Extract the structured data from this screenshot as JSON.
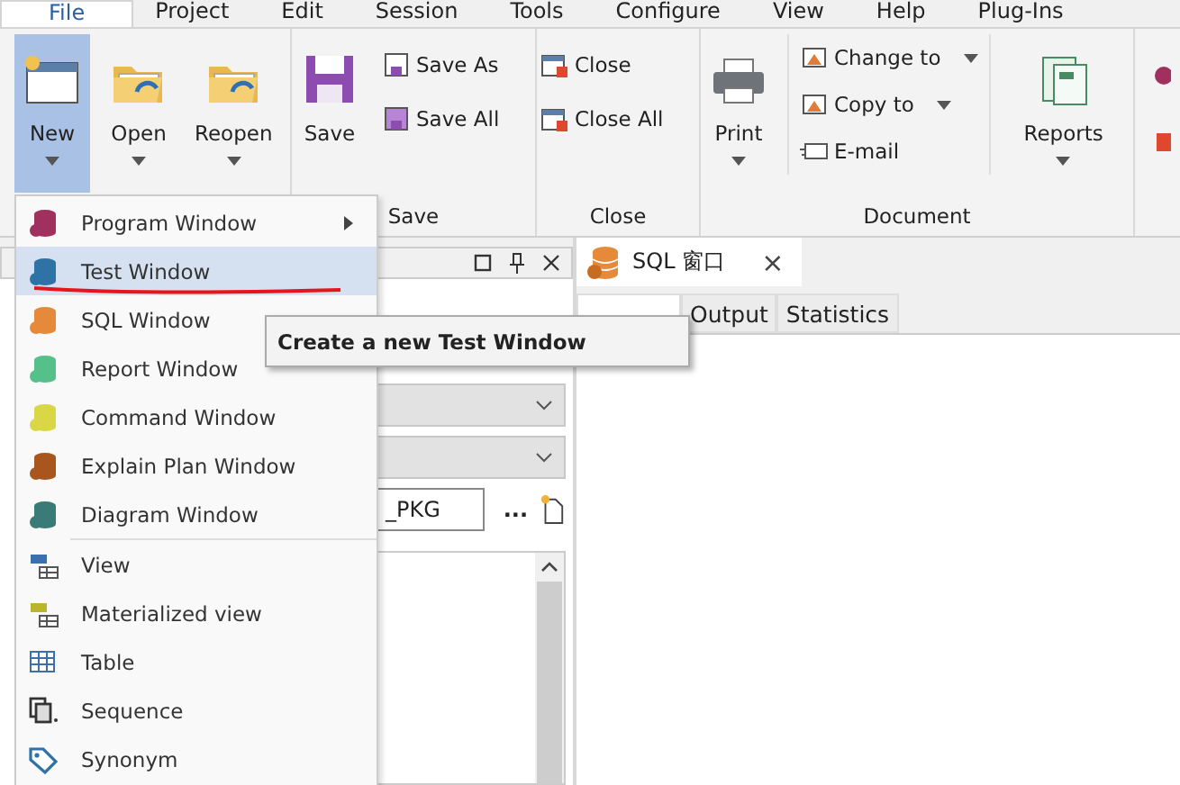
{
  "menu_bar": [
    {
      "label": "File",
      "selected": true
    },
    {
      "label": "Project",
      "selected": false
    },
    {
      "label": "Edit",
      "selected": false
    },
    {
      "label": "Session",
      "selected": false
    },
    {
      "label": "Tools",
      "selected": false
    },
    {
      "label": "Configure",
      "selected": false
    },
    {
      "label": "View",
      "selected": false
    },
    {
      "label": "Help",
      "selected": false
    },
    {
      "label": "Plug-Ins",
      "selected": false
    }
  ],
  "ribbon": {
    "groups": [
      {
        "buttons": [
          {
            "label": "New",
            "dropdown": true,
            "selected": true
          },
          {
            "label": "Open",
            "dropdown": true,
            "selected": false
          },
          {
            "label": "Reopen",
            "dropdown": true,
            "selected": false
          }
        ]
      },
      {
        "label": "Save",
        "buttons": [
          {
            "label": "Save",
            "dropdown": false,
            "selected": false
          },
          {
            "label": "Save As",
            "dropdown": false,
            "selected": false
          },
          {
            "label": "Save All",
            "dropdown": false,
            "selected": false
          }
        ]
      },
      {
        "label": "Close",
        "buttons": [
          {
            "label": "Close",
            "dropdown": false,
            "selected": false
          },
          {
            "label": "Close All",
            "dropdown": false,
            "selected": false
          }
        ]
      },
      {
        "label": "Document",
        "buttons": [
          {
            "label": "Print",
            "dropdown": true,
            "selected": false
          },
          {
            "label": "Change to",
            "dropdown": true,
            "selected": false
          },
          {
            "label": "Copy to",
            "dropdown": true,
            "selected": false
          },
          {
            "label": "E-mail",
            "dropdown": false,
            "selected": false
          },
          {
            "label": "Reports",
            "dropdown": true,
            "selected": false
          }
        ]
      }
    ]
  },
  "new_menu": {
    "items": [
      {
        "kind": "window",
        "label": "Program Window",
        "color": "#a0305e",
        "submenu": true,
        "selected": false
      },
      {
        "kind": "window",
        "label": "Test Window",
        "color": "#2f73a6",
        "submenu": false,
        "selected": true
      },
      {
        "kind": "window",
        "label": "SQL Window",
        "color": "#e48a3a",
        "submenu": false,
        "selected": false
      },
      {
        "kind": "window",
        "label": "Report Window",
        "color": "#55c08a",
        "submenu": false,
        "selected": false
      },
      {
        "kind": "window",
        "label": "Command Window",
        "color": "#d9d745",
        "submenu": false,
        "selected": false
      },
      {
        "kind": "window",
        "label": "Explain Plan Window",
        "color": "#a9561e",
        "submenu": false,
        "selected": false
      },
      {
        "kind": "window",
        "label": "Diagram Window",
        "color": "#3b7b77",
        "submenu": false,
        "selected": false
      },
      {
        "kind": "view",
        "label": "View",
        "submenu": false,
        "selected": false
      },
      {
        "kind": "mview",
        "label": "Materialized view",
        "submenu": false,
        "selected": false
      },
      {
        "kind": "table",
        "label": "Table",
        "submenu": false,
        "selected": false
      },
      {
        "kind": "sequence",
        "label": "Sequence",
        "submenu": false,
        "selected": false
      },
      {
        "kind": "synonym",
        "label": "Synonym",
        "submenu": false,
        "selected": false
      }
    ]
  },
  "tooltip": "Create a new Test Window",
  "left_panel": {
    "name_field": {
      "value": "_PKG"
    },
    "browse_button": "..."
  },
  "editor": {
    "document_tab": {
      "title": "SQL 窗口",
      "close": "×"
    },
    "tabs": [
      {
        "selected": true
      },
      {
        "label": "Output",
        "selected": false
      },
      {
        "label": "Statistics",
        "selected": false
      }
    ]
  }
}
